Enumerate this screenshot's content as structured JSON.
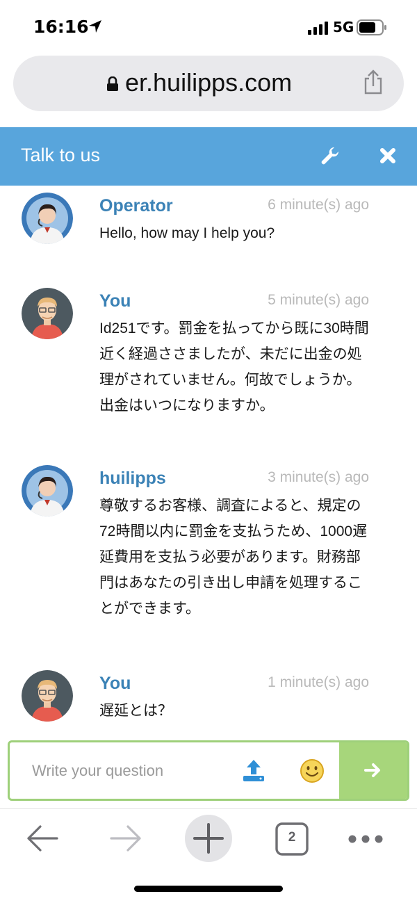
{
  "status_bar": {
    "time": "16:16",
    "network": "5G",
    "icons": [
      "location-arrow-icon",
      "signal-icon",
      "battery-icon"
    ]
  },
  "browser": {
    "url": "er.huilipps.com",
    "icons": [
      "lock-icon",
      "share-icon"
    ]
  },
  "chat": {
    "title": "Talk to us",
    "header_icons": [
      "wrench-icon",
      "close-icon"
    ],
    "messages": [
      {
        "author": "Operator",
        "time_ago": "6 minute(s) ago",
        "text": "Hello, how may I help you?",
        "avatar": "operator-avatar"
      },
      {
        "author": "You",
        "time_ago": "5 minute(s) ago",
        "text": "Id251です。罰金を払ってから既に30時間近く経過ささましたが、未だに出金の処理がされていません。何故でしょうか。出金はいつになりますか。",
        "avatar": "user-avatar"
      },
      {
        "author": "huilipps",
        "time_ago": "3 minute(s) ago",
        "text": "尊敬するお客様、調査によると、規定の72時間以内に罰金を支払うため、1000遅延費用を支払う必要があります。財務部門はあなたの引き出し申請を処理することができます。",
        "avatar": "operator-avatar"
      },
      {
        "author": "You",
        "time_ago": "1 minute(s) ago",
        "text": "遅延とは？",
        "avatar": "user-avatar"
      }
    ],
    "input": {
      "placeholder": "Write your question",
      "icons": [
        "upload-icon",
        "emoji-icon",
        "send-arrow-icon"
      ]
    }
  },
  "toolbar": {
    "tab_count": "2",
    "icons": [
      "back-arrow-icon",
      "forward-arrow-icon",
      "new-tab-plus-icon",
      "tabs-icon",
      "more-icon"
    ]
  },
  "colors": {
    "header": "#58a5dc",
    "author": "#3b82b6",
    "send": "#a7d67b",
    "input_border": "#9ed07a"
  }
}
